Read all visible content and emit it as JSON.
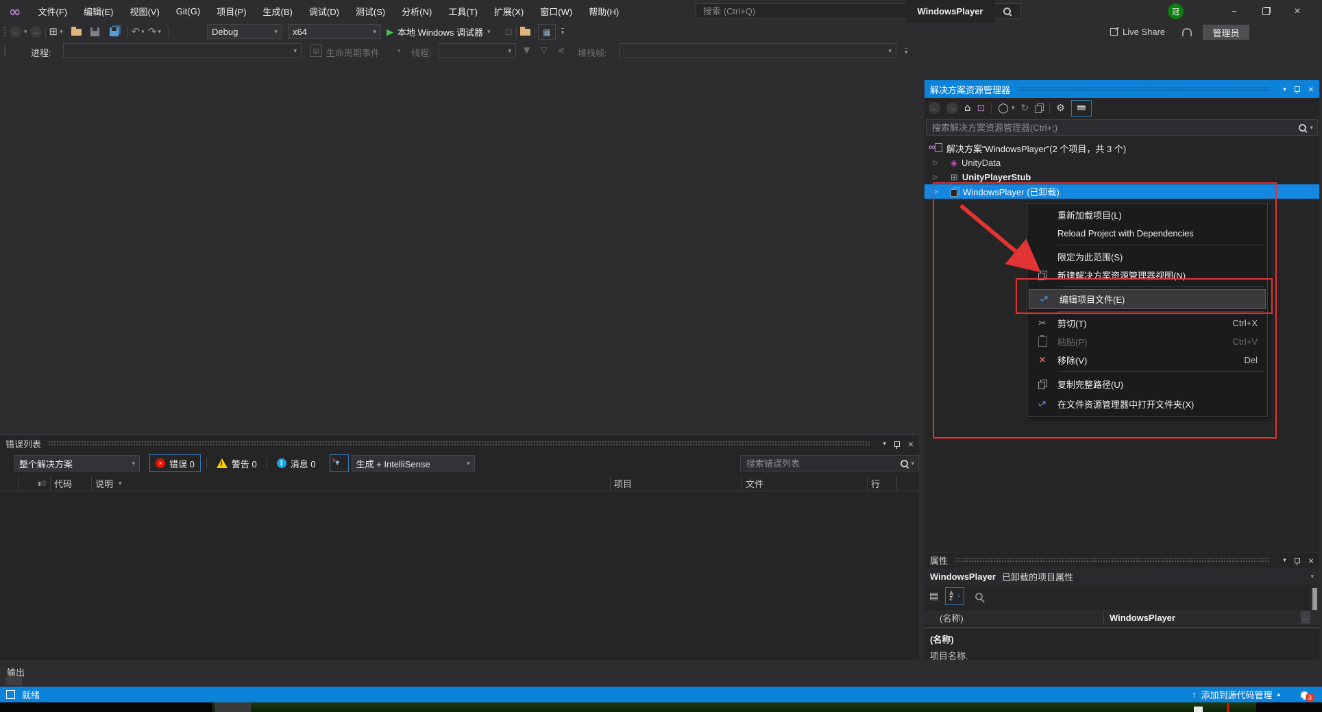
{
  "window": {
    "title": "WindowsPlayer",
    "user_badge": "冠"
  },
  "title_bar": {
    "menus": [
      "文件(F)",
      "编辑(E)",
      "视图(V)",
      "Git(G)",
      "项目(P)",
      "生成(B)",
      "调试(D)",
      "测试(S)",
      "分析(N)",
      "工具(T)",
      "扩展(X)",
      "窗口(W)",
      "帮助(H)"
    ],
    "search_placeholder": "搜索 (Ctrl+Q)"
  },
  "toolbar": {
    "configuration": "Debug",
    "platform": "x64",
    "start_label": "本地 Windows 调试器",
    "live_share": "Live Share",
    "admin": "管理员"
  },
  "debug_toolbar": {
    "process": "进程:",
    "lifecycle": "生命周期事件",
    "thread": "线程:",
    "stack_frame": "堆栈帧:"
  },
  "solution_explorer": {
    "title": "解决方案资源管理器",
    "search_placeholder": "搜索解决方案资源管理器(Ctrl+;)",
    "tree": [
      {
        "label": "解决方案“WindowsPlayer”(2 个项目，共 3 个)"
      },
      {
        "label": "UnityData"
      },
      {
        "label": "UnityPlayerStub"
      },
      {
        "label": "WindowsPlayer (已卸载)"
      }
    ]
  },
  "context_menu": {
    "items": [
      {
        "label": "重新加载项目(L)",
        "shortcut": ""
      },
      {
        "label": "Reload Project with Dependencies",
        "shortcut": ""
      },
      {
        "label": "限定为此范围(S)",
        "shortcut": ""
      },
      {
        "label": "新建解决方案资源管理器视图(N)",
        "shortcut": ""
      },
      {
        "label": "编辑项目文件(E)",
        "shortcut": ""
      },
      {
        "label": "剪切(T)",
        "shortcut": "Ctrl+X"
      },
      {
        "label": "粘贴(P)",
        "shortcut": "Ctrl+V"
      },
      {
        "label": "移除(V)",
        "shortcut": "Del"
      },
      {
        "label": "复制完整路径(U)",
        "shortcut": ""
      },
      {
        "label": "在文件资源管理器中打开文件夹(X)",
        "shortcut": ""
      }
    ]
  },
  "error_list": {
    "title": "错误列表",
    "scope": "整个解决方案",
    "errors": "错误 0",
    "warnings": "警告 0",
    "messages": "消息 0",
    "build_filter": "生成 + IntelliSense",
    "search_placeholder": "搜索错误列表",
    "columns": [
      "代码",
      "说明",
      "项目",
      "文件",
      "行"
    ]
  },
  "properties_panel": {
    "title": "属性",
    "object_name": "WindowsPlayer",
    "object_desc": "已卸载的项目属性",
    "row_name": "(名称)",
    "row_value": "WindowsPlayer",
    "description_title": "(名称)",
    "description_text": "项目名称."
  },
  "output_panel": {
    "title": "输出"
  },
  "status_bar": {
    "ready": "就绪",
    "source_control": "添加到源代码管理",
    "notifications": "3"
  },
  "colors": {
    "accent": "#0d82d9",
    "selection": "#1487e0",
    "annotation": "#e23434",
    "avatar_green": "#107c10",
    "error_red": "#e51400",
    "warning_yellow": "#fc0",
    "info_blue": "#1ba1e2"
  }
}
